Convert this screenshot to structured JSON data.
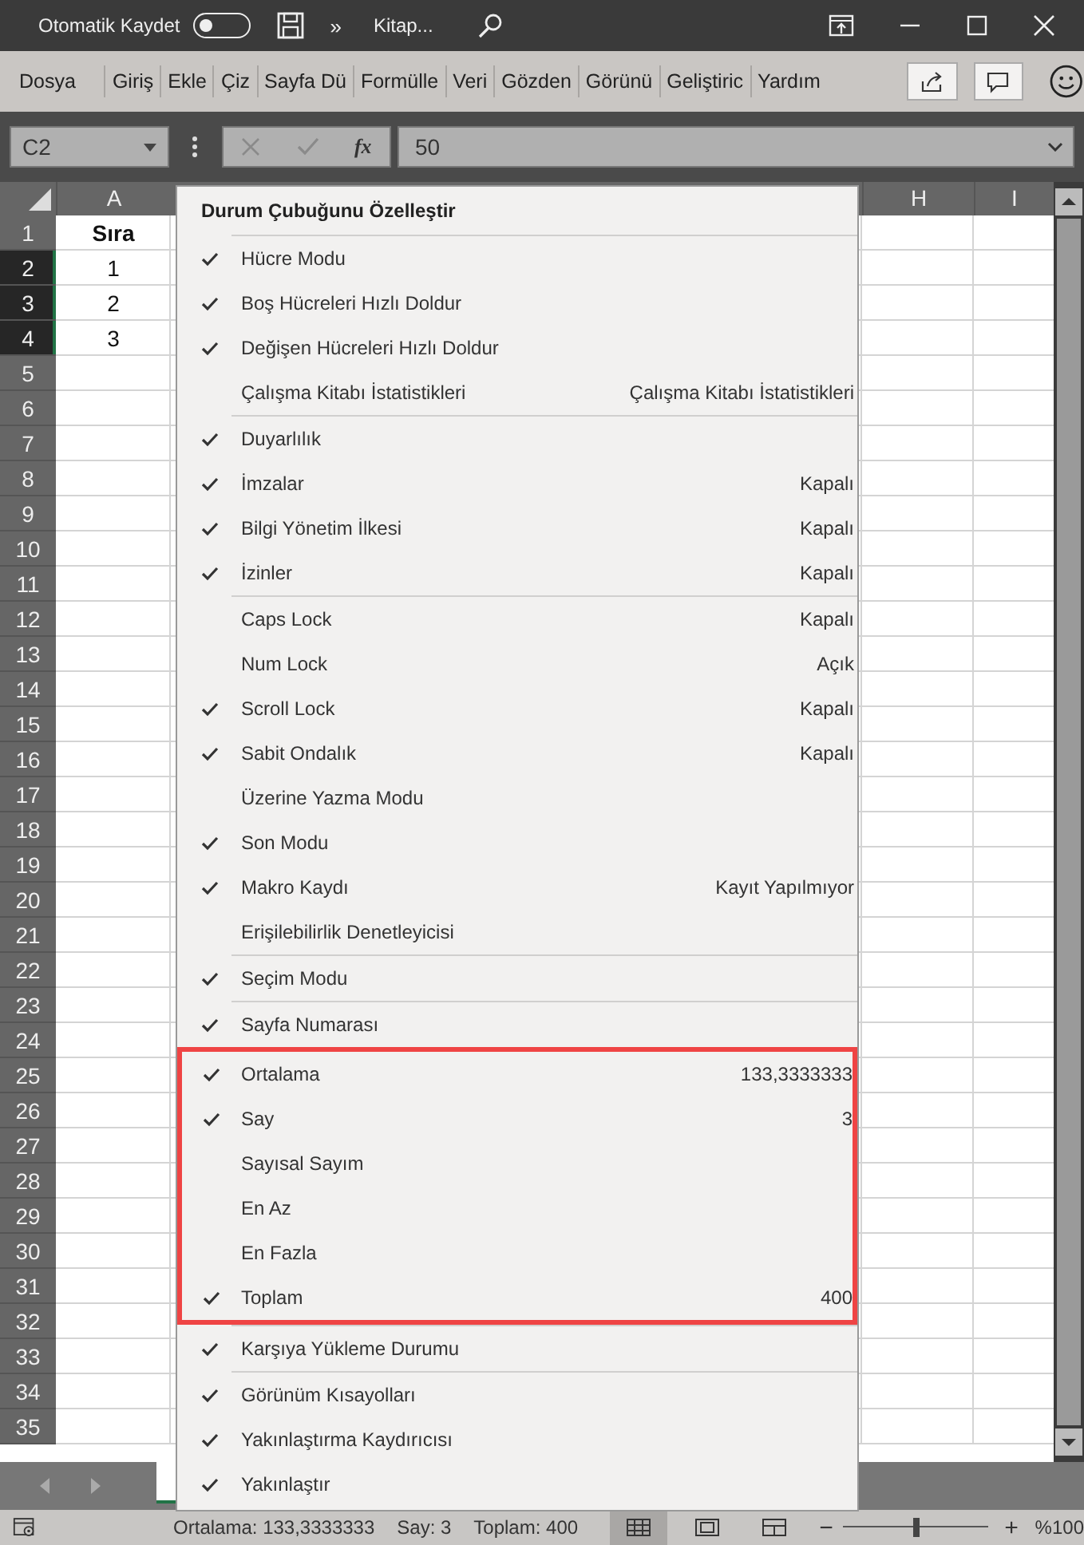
{
  "title_bar": {
    "autosave": {
      "label": "Otomatik Kaydet",
      "on": false
    },
    "more": "»",
    "document": "Kitap..."
  },
  "ribbon_tabs": [
    "Dosya",
    "Giriş",
    "Ekle",
    "Çiz",
    "Sayfa Dü",
    "Formülle",
    "Veri",
    "Gözden",
    "Görünü",
    "Geliştiric",
    "Yardım"
  ],
  "formula_bar": {
    "name_box": "C2",
    "function_label": "fx",
    "value": "50"
  },
  "columns": [
    "A",
    "H",
    "I"
  ],
  "rows": [
    {
      "number": "1",
      "selected": false,
      "cell_a": {
        "text": "Sıra",
        "bold": true
      }
    },
    {
      "number": "2",
      "selected": true,
      "cell_a": {
        "text": "1",
        "bold": false
      }
    },
    {
      "number": "3",
      "selected": true,
      "cell_a": {
        "text": "2",
        "bold": false
      }
    },
    {
      "number": "4",
      "selected": true,
      "cell_a": {
        "text": "3",
        "bold": false
      }
    },
    {
      "number": "5",
      "selected": false
    },
    {
      "number": "6",
      "selected": false
    },
    {
      "number": "7",
      "selected": false
    },
    {
      "number": "8",
      "selected": false
    },
    {
      "number": "9",
      "selected": false
    },
    {
      "number": "10",
      "selected": false
    },
    {
      "number": "11",
      "selected": false
    },
    {
      "number": "12",
      "selected": false
    },
    {
      "number": "13",
      "selected": false
    },
    {
      "number": "14",
      "selected": false
    },
    {
      "number": "15",
      "selected": false
    },
    {
      "number": "16",
      "selected": false
    },
    {
      "number": "17",
      "selected": false
    },
    {
      "number": "18",
      "selected": false
    },
    {
      "number": "19",
      "selected": false
    },
    {
      "number": "20",
      "selected": false
    },
    {
      "number": "21",
      "selected": false
    },
    {
      "number": "22",
      "selected": false
    },
    {
      "number": "23",
      "selected": false
    },
    {
      "number": "24",
      "selected": false
    },
    {
      "number": "25",
      "selected": false
    },
    {
      "number": "26",
      "selected": false
    },
    {
      "number": "27",
      "selected": false
    },
    {
      "number": "28",
      "selected": false
    },
    {
      "number": "29",
      "selected": false
    },
    {
      "number": "30",
      "selected": false
    },
    {
      "number": "31",
      "selected": false
    },
    {
      "number": "32",
      "selected": false
    },
    {
      "number": "33",
      "selected": false
    },
    {
      "number": "34",
      "selected": false
    },
    {
      "number": "35",
      "selected": false
    }
  ],
  "menu": {
    "title": "Durum Çubuğunu Özelleştir",
    "groups": [
      {
        "highlighted": false,
        "items": [
          {
            "label": "Hücre Modu",
            "checked": true
          },
          {
            "label": "Boş Hücreleri Hızlı Doldur",
            "checked": true
          },
          {
            "label": "Değişen Hücreleri Hızlı Doldur",
            "checked": true
          },
          {
            "label": "Çalışma Kitabı İstatistikleri",
            "checked": false,
            "value": "Çalışma Kitabı İstatistikleri"
          }
        ]
      },
      {
        "highlighted": false,
        "items": [
          {
            "label": "Duyarlılık",
            "checked": true
          },
          {
            "label": "İmzalar",
            "checked": true,
            "value": "Kapalı"
          },
          {
            "label": "Bilgi Yönetim İlkesi",
            "checked": true,
            "value": "Kapalı"
          },
          {
            "label": "İzinler",
            "checked": true,
            "value": "Kapalı"
          }
        ]
      },
      {
        "highlighted": false,
        "items": [
          {
            "label": "Caps Lock",
            "checked": false,
            "value": "Kapalı"
          },
          {
            "label": "Num Lock",
            "checked": false,
            "value": "Açık"
          },
          {
            "label": "Scroll Lock",
            "checked": true,
            "value": "Kapalı"
          },
          {
            "label": "Sabit Ondalık",
            "checked": true,
            "value": "Kapalı"
          },
          {
            "label": "Üzerine Yazma Modu",
            "checked": false
          },
          {
            "label": "Son Modu",
            "checked": true
          },
          {
            "label": "Makro Kaydı",
            "checked": true,
            "value": "Kayıt Yapılmıyor"
          },
          {
            "label": "Erişilebilirlik Denetleyicisi",
            "checked": false
          }
        ]
      },
      {
        "highlighted": false,
        "items": [
          {
            "label": "Seçim Modu",
            "checked": true
          }
        ]
      },
      {
        "highlighted": false,
        "items": [
          {
            "label": "Sayfa Numarası",
            "checked": true
          }
        ]
      },
      {
        "highlighted": true,
        "items": [
          {
            "label": "Ortalama",
            "checked": true,
            "value": "133,3333333"
          },
          {
            "label": "Say",
            "checked": true,
            "value": "3"
          },
          {
            "label": "Sayısal Sayım",
            "checked": false
          },
          {
            "label": "En Az",
            "checked": false
          },
          {
            "label": "En Fazla",
            "checked": false
          },
          {
            "label": "Toplam",
            "checked": true,
            "value": "400"
          }
        ]
      },
      {
        "highlighted": false,
        "items": [
          {
            "label": "Karşıya Yükleme Durumu",
            "checked": true
          }
        ]
      },
      {
        "highlighted": false,
        "items": [
          {
            "label": "Görünüm Kısayolları",
            "checked": true
          },
          {
            "label": "Yakınlaştırma Kaydırıcısı",
            "checked": true
          },
          {
            "label": "Yakınlaştır",
            "checked": true
          }
        ]
      }
    ]
  },
  "status_bar": {
    "stats": [
      "Ortalama: 133,3333333",
      "Say: 3",
      "Toplam: 400"
    ],
    "views": [
      {
        "kind": "normal",
        "selected": true
      },
      {
        "kind": "page_layout",
        "selected": false
      },
      {
        "kind": "page_break",
        "selected": false
      }
    ],
    "zoom_slider": {
      "level": 0.5
    },
    "zoom": "%100"
  }
}
